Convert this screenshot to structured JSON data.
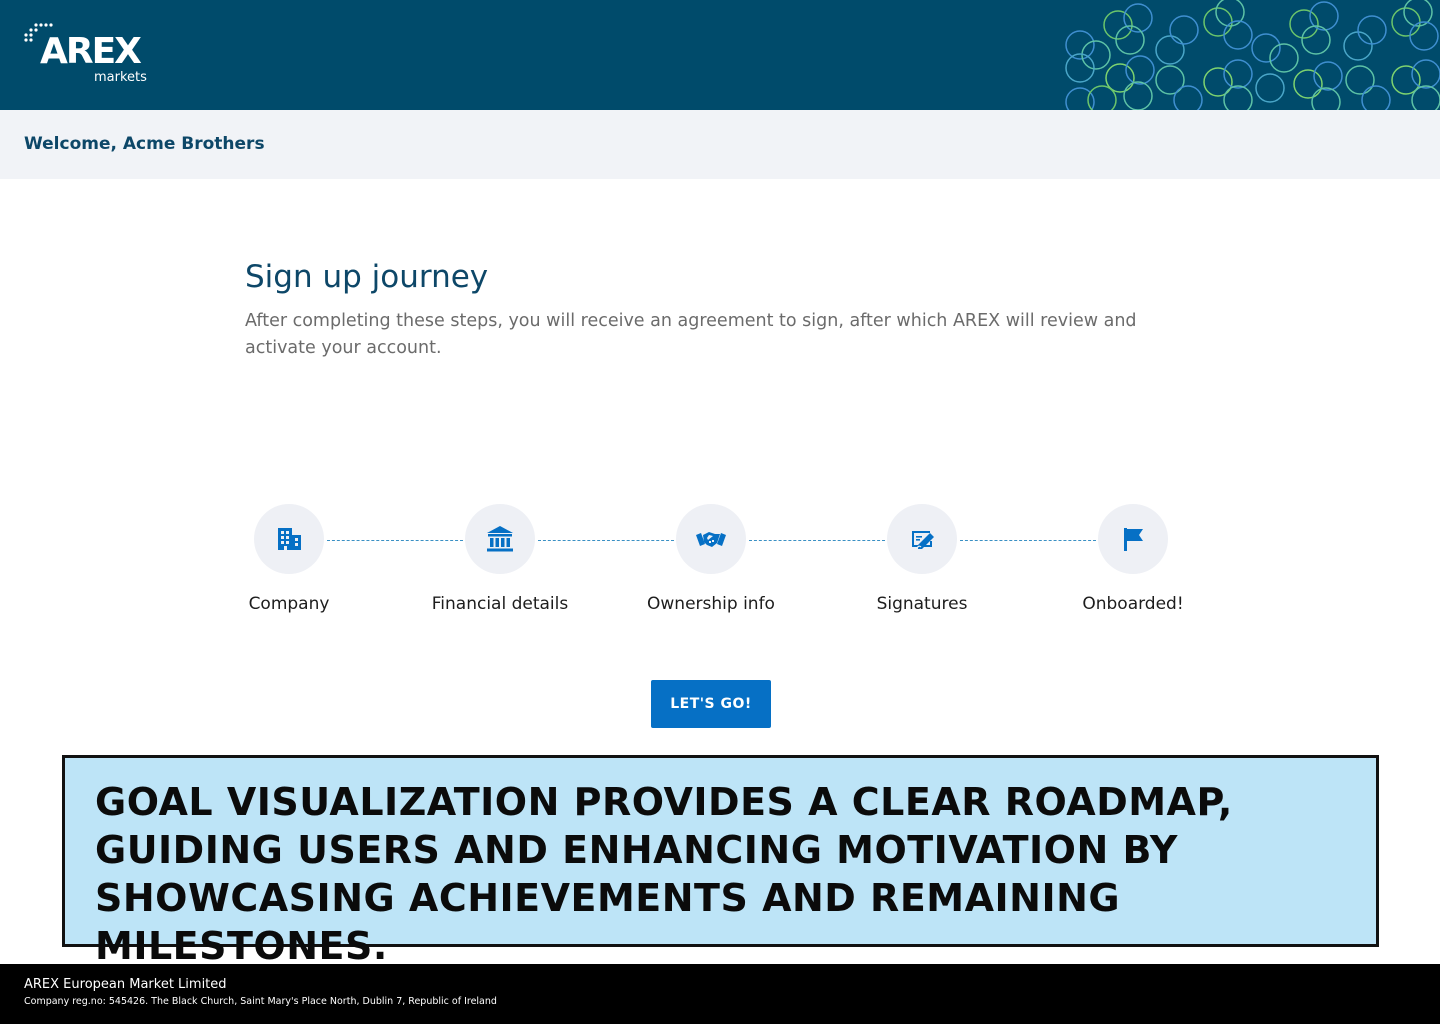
{
  "brand": {
    "name": "AREX",
    "subtitle": "markets",
    "header_color": "#004b6b"
  },
  "welcome": {
    "text": "Welcome, Acme Brothers"
  },
  "main": {
    "title": "Sign up journey",
    "description": "After completing these steps, you will receive an agreement to sign, after which AREX will review and activate your account."
  },
  "steps": [
    {
      "label": "Company",
      "icon": "building-icon"
    },
    {
      "label": "Financial details",
      "icon": "bank-icon"
    },
    {
      "label": "Ownership info",
      "icon": "handshake-icon"
    },
    {
      "label": "Signatures",
      "icon": "signature-icon"
    },
    {
      "label": "Onboarded!",
      "icon": "flag-icon"
    }
  ],
  "cta": {
    "label": "LET'S GO!",
    "color": "#0670c5"
  },
  "callout": {
    "text": "Goal visualization provides a clear roadmap, guiding users and enhancing motivation by showcasing achievements and remaining milestones.",
    "background": "#bde4f7"
  },
  "footer": {
    "company": "AREX European Market Limited",
    "address": "Company reg.no: 545426. The Black Church, Saint Mary's Place North, Dublin 7, Republic of Ireland"
  }
}
